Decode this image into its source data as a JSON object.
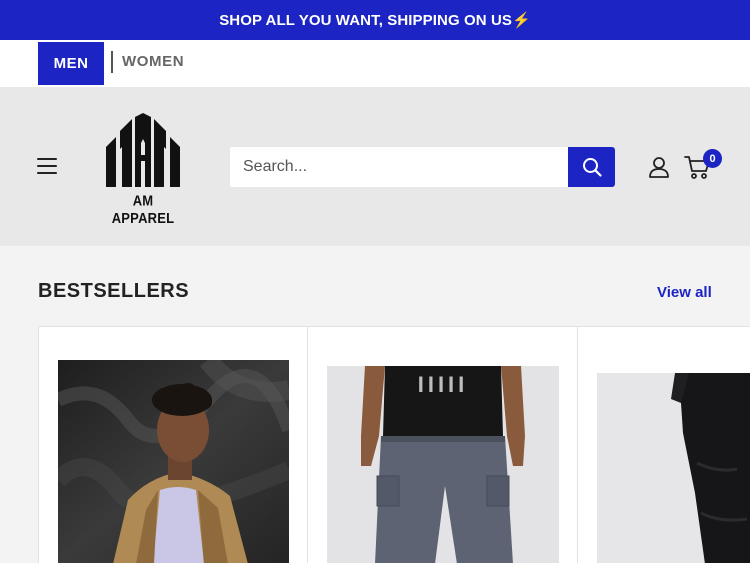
{
  "announcement": {
    "text": "SHOP ALL YOU WANT, SHIPPING ON US⚡"
  },
  "gender_nav": {
    "men_label": "MEN",
    "women_label": "WOMEN"
  },
  "header": {
    "logo_text": "AM APPAREL",
    "search": {
      "placeholder": "Search...",
      "value": ""
    },
    "cart_count": "0"
  },
  "bestsellers": {
    "title": "BESTSELLERS",
    "view_all_label": "View all",
    "products": [
      {
        "image_icon": "man-in-tan-jacket-photo"
      },
      {
        "image_icon": "grey-cargo-pants-photo"
      },
      {
        "image_icon": "black-joggers-photo"
      }
    ]
  },
  "colors": {
    "accent": "#1c24c4",
    "header_bg": "#e8e8e8",
    "page_bg": "#f3f3f3"
  }
}
